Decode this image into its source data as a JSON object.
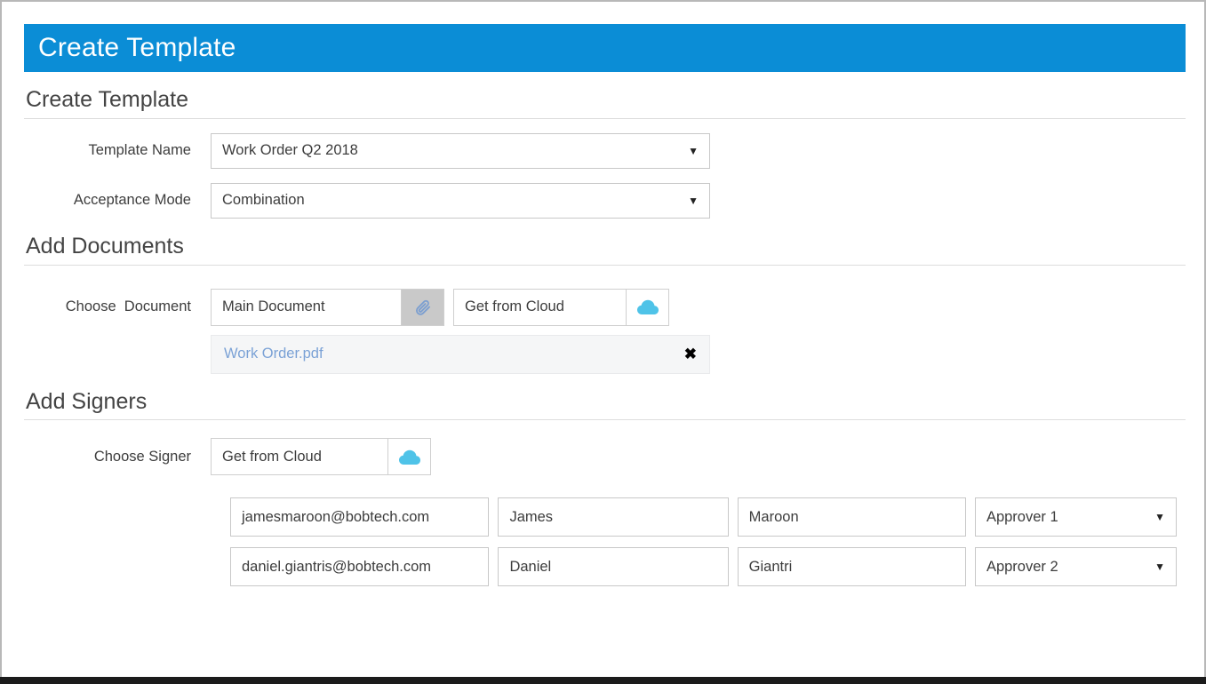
{
  "window": {
    "title": "Create Template",
    "accent_color": "#0b8dd6"
  },
  "sections": {
    "create_template": {
      "heading": "Create Template",
      "fields": {
        "template_name": {
          "label": "Template Name",
          "value": "Work Order Q2 2018",
          "caret": "▼"
        },
        "acceptance_mode": {
          "label": "Acceptance Mode",
          "value": "Combination",
          "caret": "▼"
        }
      }
    },
    "add_documents": {
      "heading": "Add Documents",
      "label": "Choose  Document",
      "main_document_button": "Main Document",
      "attach_icon": "paperclip-icon",
      "get_from_cloud_button": "Get from Cloud",
      "cloud_icon": "cloud-icon",
      "attached_files": [
        {
          "name": "Work Order.pdf",
          "remove": "✖"
        }
      ]
    },
    "add_signers": {
      "heading": "Add Signers",
      "label": "Choose Signer",
      "get_from_cloud_button": "Get from Cloud",
      "cloud_icon": "cloud-icon",
      "signers": [
        {
          "email": "jamesmaroon@bobtech.com",
          "first_name": "James",
          "last_name": "Maroon",
          "role": "Approver 1",
          "caret": "▼"
        },
        {
          "email": "daniel.giantris@bobtech.com",
          "first_name": "Daniel",
          "last_name": "Giantri",
          "role": "Approver 2",
          "caret": "▼"
        }
      ]
    }
  },
  "colors": {
    "cloud_blue": "#4fc3e8",
    "paperclip_blue": "#7c9fd0",
    "link_blue": "#7ba2d6"
  }
}
